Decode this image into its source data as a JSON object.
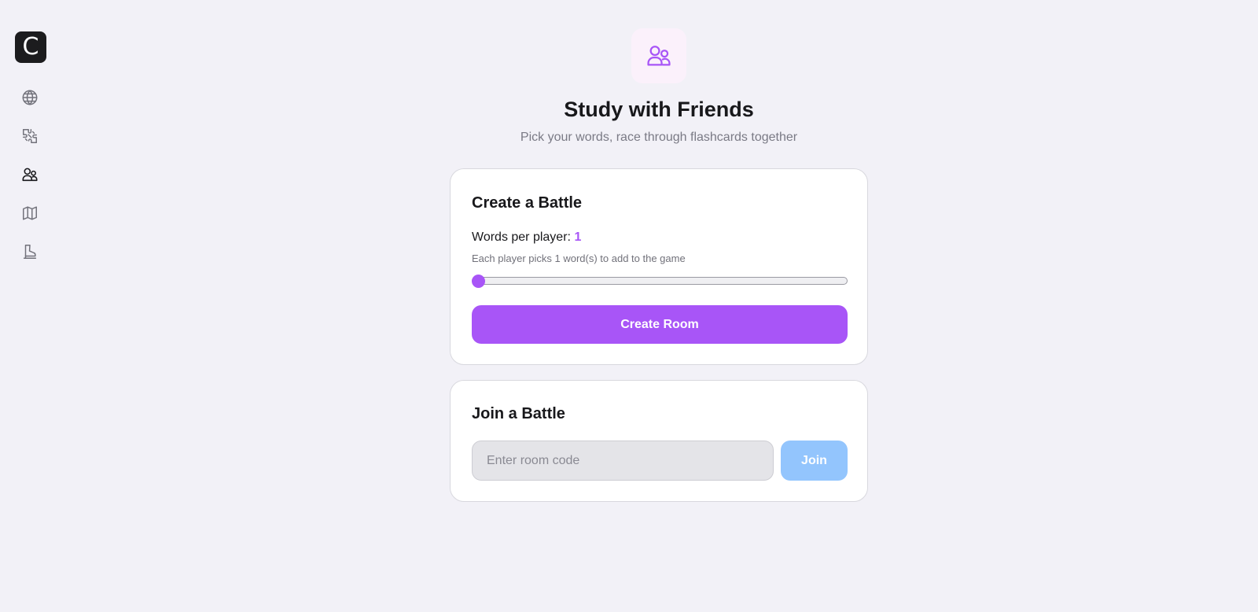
{
  "sidebar": {
    "logo_letter": "C",
    "items": [
      {
        "icon": "globe-icon"
      },
      {
        "icon": "puzzle-icon"
      },
      {
        "icon": "users-icon",
        "active": true
      },
      {
        "icon": "map-icon"
      },
      {
        "icon": "boot-icon"
      }
    ]
  },
  "hero": {
    "icon": "users-icon",
    "title": "Study with Friends",
    "subtitle": "Pick your words, race through flashcards together"
  },
  "create_battle": {
    "title": "Create a Battle",
    "words_label": "Words per player:",
    "words_value": "1",
    "hint": "Each player picks 1 word(s) to add to the game",
    "slider_fraction": 0,
    "button_label": "Create Room"
  },
  "join_battle": {
    "title": "Join a Battle",
    "input_value": "",
    "input_placeholder": "Enter room code",
    "button_label": "Join"
  },
  "colors": {
    "accent": "#a855f7",
    "join_button": "#93c5fd",
    "background": "#f2f1f7",
    "logo_bg": "#1c1c1e"
  }
}
